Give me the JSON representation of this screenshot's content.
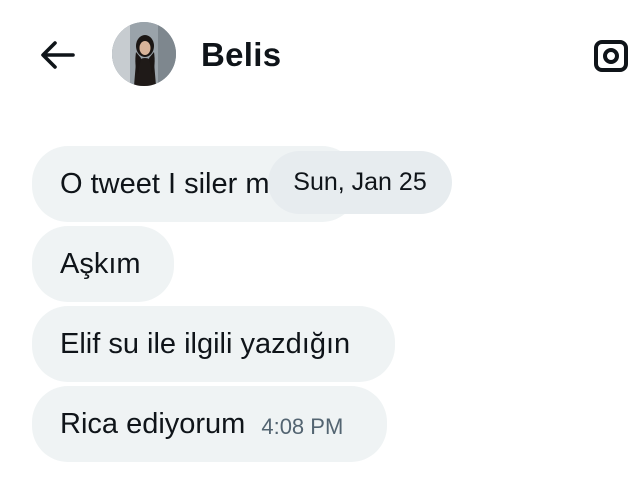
{
  "header": {
    "contact_name": "Belis",
    "back_icon": "arrow-left-icon",
    "camera_icon": "camera-icon"
  },
  "messages": [
    {
      "text": "O tweet I siler mi",
      "time": ""
    },
    {
      "text": "Aşkım",
      "time": ""
    },
    {
      "text": "Elif su ile ilgili yazdığın",
      "time": ""
    },
    {
      "text": "Rica ediyorum",
      "time": "4:08 PM"
    }
  ],
  "date_separator": "Sun, Jan 25",
  "colors": {
    "bubble_bg": "#eff3f4",
    "date_pill_bg": "#e7ecef",
    "text": "#0f1419",
    "secondary_text": "#536471"
  }
}
